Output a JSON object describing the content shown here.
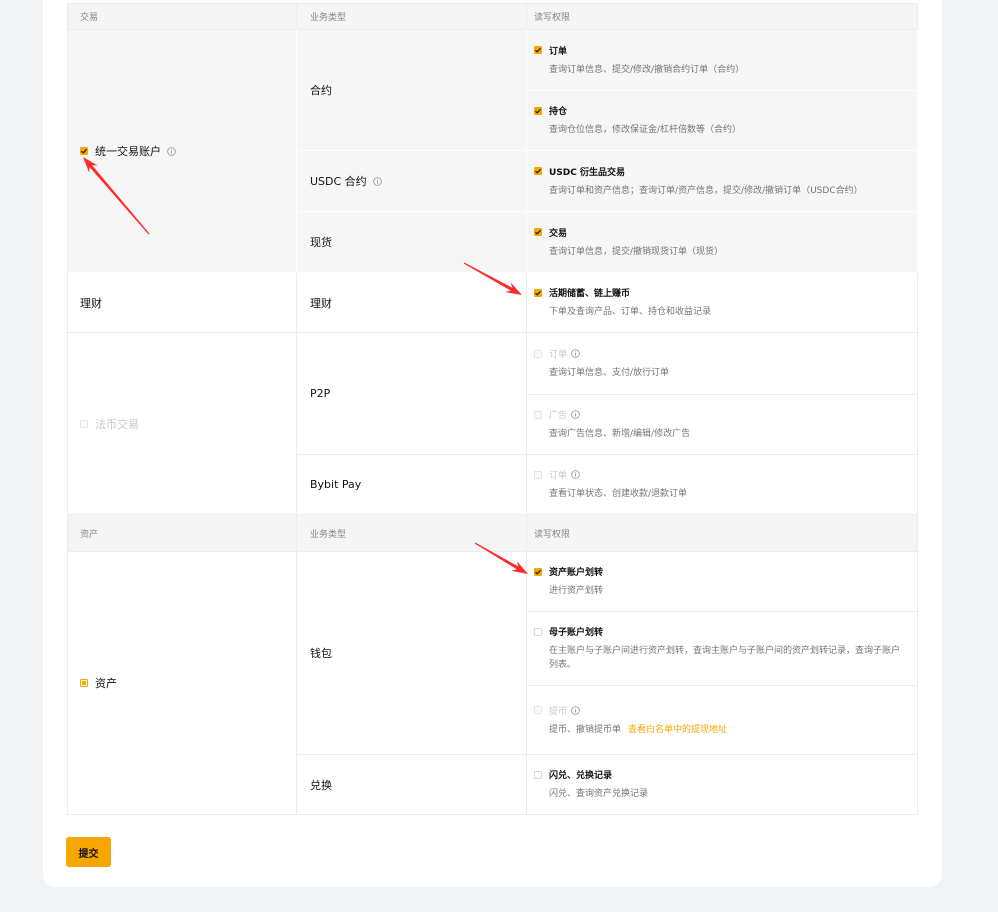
{
  "colors": {
    "accent": "#f7a600",
    "annotation": "#ff2a2a"
  },
  "icons": {
    "info": "info-icon",
    "check": "check-icon"
  },
  "trade_header": {
    "category": "交易",
    "business_type": "业务类型",
    "permission": "读写权限"
  },
  "unified_trading": {
    "label": "统一交易账户",
    "state": "checked",
    "types": {
      "contract": "合约",
      "usdc_contract": "USDC 合约",
      "spot": "现货"
    },
    "permissions": {
      "order": {
        "label": "订单",
        "desc": "查询订单信息、提交/修改/撤销合约订单（合约）",
        "state": "checked"
      },
      "position": {
        "label": "持仓",
        "desc": "查询仓位信息，修改保证金/杠杆倍数等（合约）",
        "state": "checked"
      },
      "usdc": {
        "label": "USDC 衍生品交易",
        "desc": "查询订单和资产信息；查询订单/资产信息，提交/修改/撤销订单（USDC合约）",
        "state": "checked"
      },
      "spot_trade": {
        "label": "交易",
        "desc": "查询订单信息，提交/撤销现货订单（现货）",
        "state": "checked"
      }
    }
  },
  "earn": {
    "category": "理财",
    "type": "理财",
    "permission": {
      "label": "活期储蓄、链上赚币",
      "desc": "下单及查询产品、订单、持仓和收益记录",
      "state": "checked"
    }
  },
  "fiat": {
    "label": "法币交易",
    "state": "disabled",
    "types": {
      "p2p": "P2P",
      "bybit_pay": "Bybit Pay"
    },
    "permissions": {
      "p2p_order": {
        "label": "订单",
        "desc": "查询订单信息、支付/放行订单",
        "state": "disabled"
      },
      "p2p_ad": {
        "label": "广告",
        "desc": "查询广告信息、新增/编辑/修改广告",
        "state": "disabled"
      },
      "pay_order": {
        "label": "订单",
        "desc": "查看订单状态、创建收款/退款订单",
        "state": "disabled"
      }
    }
  },
  "asset_header": {
    "category": "资产",
    "business_type": "业务类型",
    "permission": "读写权限"
  },
  "assets": {
    "label": "资产",
    "state": "indeterminate",
    "types": {
      "wallet": "钱包",
      "exchange": "兑换"
    },
    "permissions": {
      "account_transfer": {
        "label": "资产账户划转",
        "desc": "进行资产划转",
        "state": "checked"
      },
      "subaccount_transfer": {
        "label": "母子账户划转",
        "desc": "在主账户与子账户间进行资产划转，查询主账户与子账户间的资产划转记录，查询子账户列表。",
        "state": "unchecked"
      },
      "withdraw": {
        "label": "提币",
        "desc": "提币、撤销提币单",
        "link": "查看白名单中的提现地址",
        "state": "disabled"
      },
      "convert": {
        "label": "闪兑、兑换记录",
        "desc": "闪兑、查询资产兑换记录",
        "state": "unchecked"
      }
    }
  },
  "page": {
    "submit_label": "提交"
  }
}
